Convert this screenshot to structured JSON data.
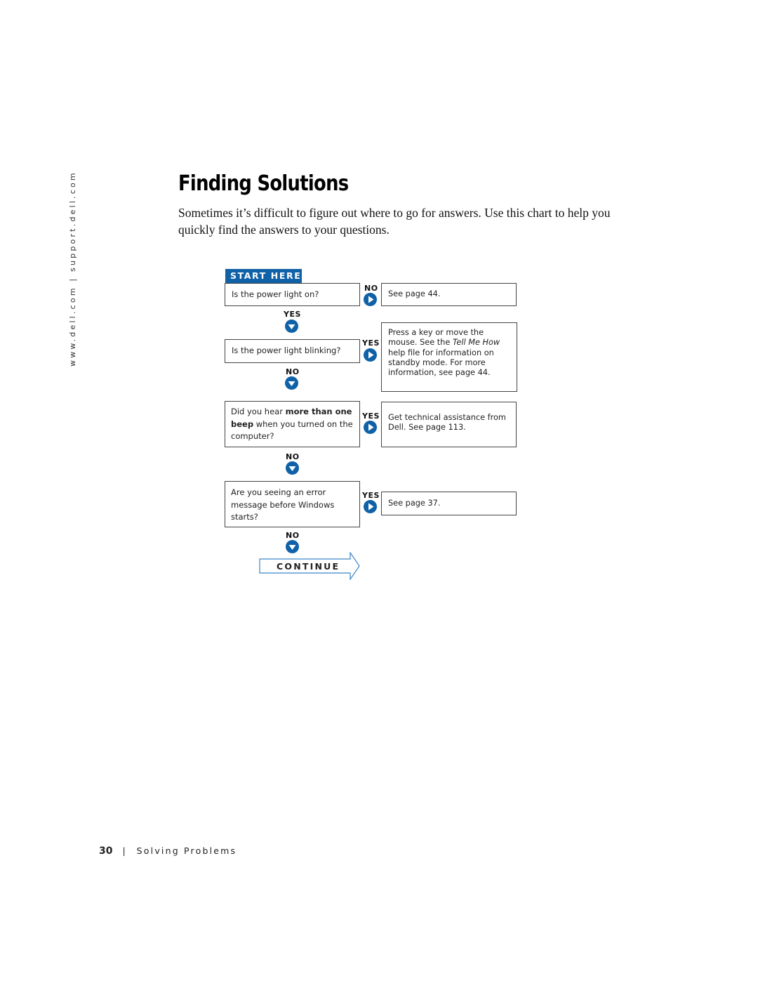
{
  "side_url": "www.dell.com | support.dell.com",
  "title": "Finding Solutions",
  "intro": "Sometimes it’s difficult to figure out where to go for answers. Use this chart to help you quickly find the answers to your questions.",
  "flowchart": {
    "start_label": "START HERE",
    "questions": [
      {
        "text": "Is the power light on?"
      },
      {
        "text": "Is the power light blinking?"
      },
      {
        "text_before": "Did you hear ",
        "text_bold": "more than one beep",
        "text_after": " when you turned on the computer?"
      },
      {
        "text": "Are you seeing an error message before Windows starts?"
      }
    ],
    "answers": [
      {
        "branch": "NO",
        "text": "See page 44."
      },
      {
        "branch": "YES",
        "text_before": "Press a key or move the mouse. See the ",
        "text_italic": "Tell Me How",
        "text_after": " help file for information on standby mode. For more information, see page 44."
      },
      {
        "branch": "YES",
        "text": "Get technical assistance from Dell. See page 113."
      },
      {
        "branch": "YES",
        "text": "See page 37."
      }
    ],
    "down_labels": [
      "YES",
      "NO",
      "NO",
      "NO"
    ],
    "continue_label": "CONTINUE",
    "accent_color": "#0f61a8"
  },
  "footer": {
    "page_number": "30",
    "separator": "|",
    "section": "Solving Problems"
  }
}
